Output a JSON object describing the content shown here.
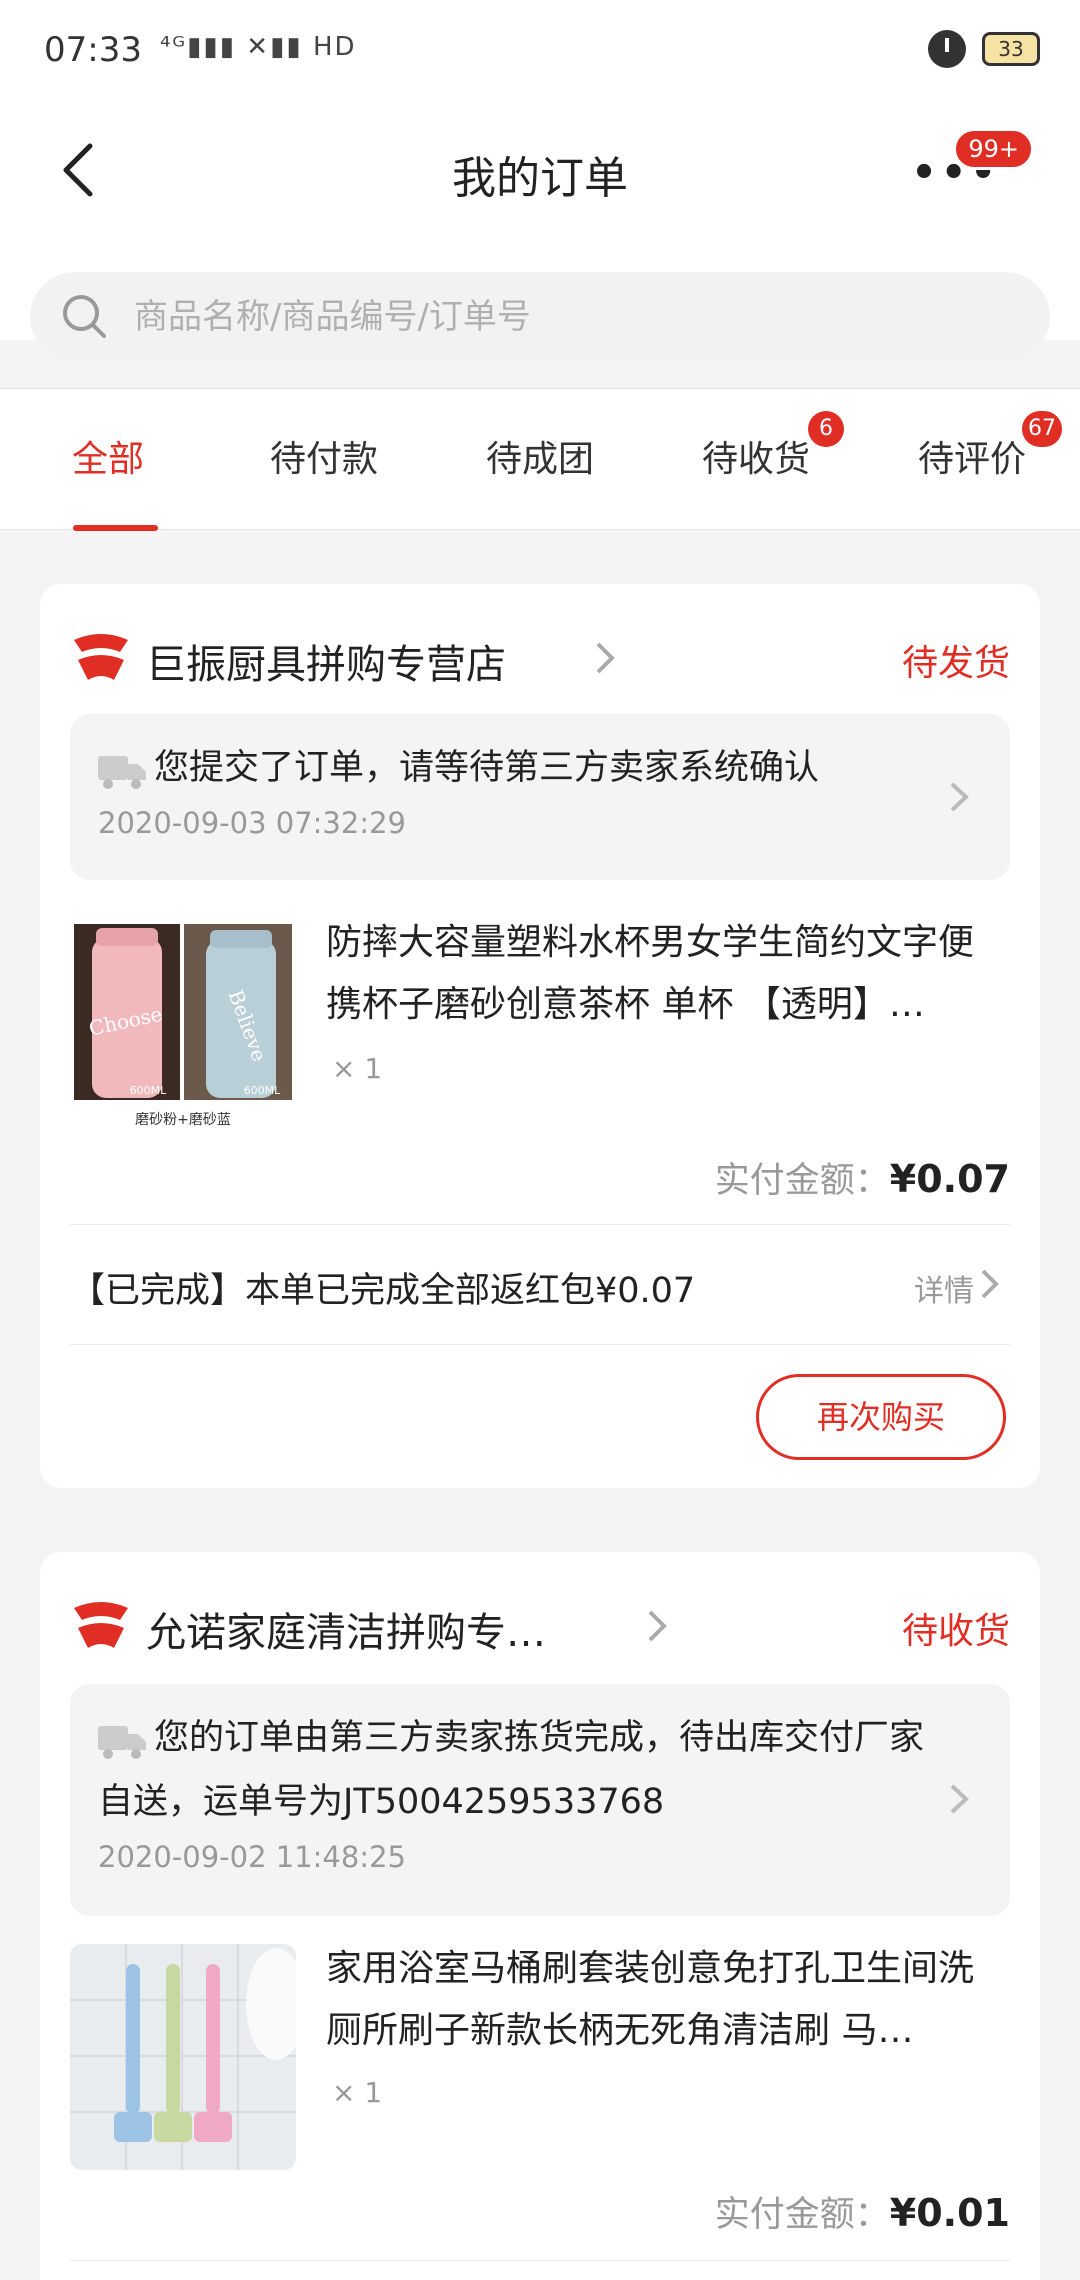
{
  "status_bar": {
    "time": "07:33",
    "network": "⁴ᴳ▮▮▮ ✕▮▮ HD",
    "battery": "33"
  },
  "header": {
    "title": "我的订单",
    "more_label": "•••",
    "more_badge": "99+"
  },
  "search": {
    "placeholder": "商品名称/商品编号/订单号"
  },
  "tabs": [
    {
      "label": "全部",
      "badge": ""
    },
    {
      "label": "待付款",
      "badge": ""
    },
    {
      "label": "待成团",
      "badge": ""
    },
    {
      "label": "待收货",
      "badge": "6"
    },
    {
      "label": "待评价",
      "badge": "67"
    }
  ],
  "orders": [
    {
      "shop_name": "巨振厨具拼购专营店",
      "status": "待发货",
      "notice": "您提交了订单，请等待第三方卖家系统确认",
      "notice_time": "2020-09-03 07:32:29",
      "product_title": "防摔大容量塑料水杯男女学生简约文字便携杯子磨砂创意茶杯 单杯 【透明】…",
      "product_image_text": [
        "Choose",
        "Believe",
        "600ML",
        "600ML",
        "磨砂粉+磨砂蓝"
      ],
      "qty": "× 1",
      "pay_label": "实付金额：",
      "pay_amount": "¥0.07",
      "rebate": "【已完成】本单已完成全部返红包¥0.07",
      "rebate_detail": "详情",
      "rebuy_label": "再次购买"
    },
    {
      "shop_name": "允诺家庭清洁拼购专…",
      "status": "待收货",
      "notice": "您的订单由第三方卖家拣货完成，待出库交付厂家自送，运单号为JT5004259533768",
      "notice_time": "2020-09-02 11:48:25",
      "product_title": "家用浴室马桶刷套装创意免打孔卫生间洗厕所刷子新款长柄无死角清洁刷 马…",
      "qty": "× 1",
      "pay_label": "实付金额：",
      "pay_amount": "¥0.01"
    }
  ],
  "colors": {
    "accent": "#e02e24",
    "background": "#f4f4f4",
    "muted": "#999999"
  }
}
